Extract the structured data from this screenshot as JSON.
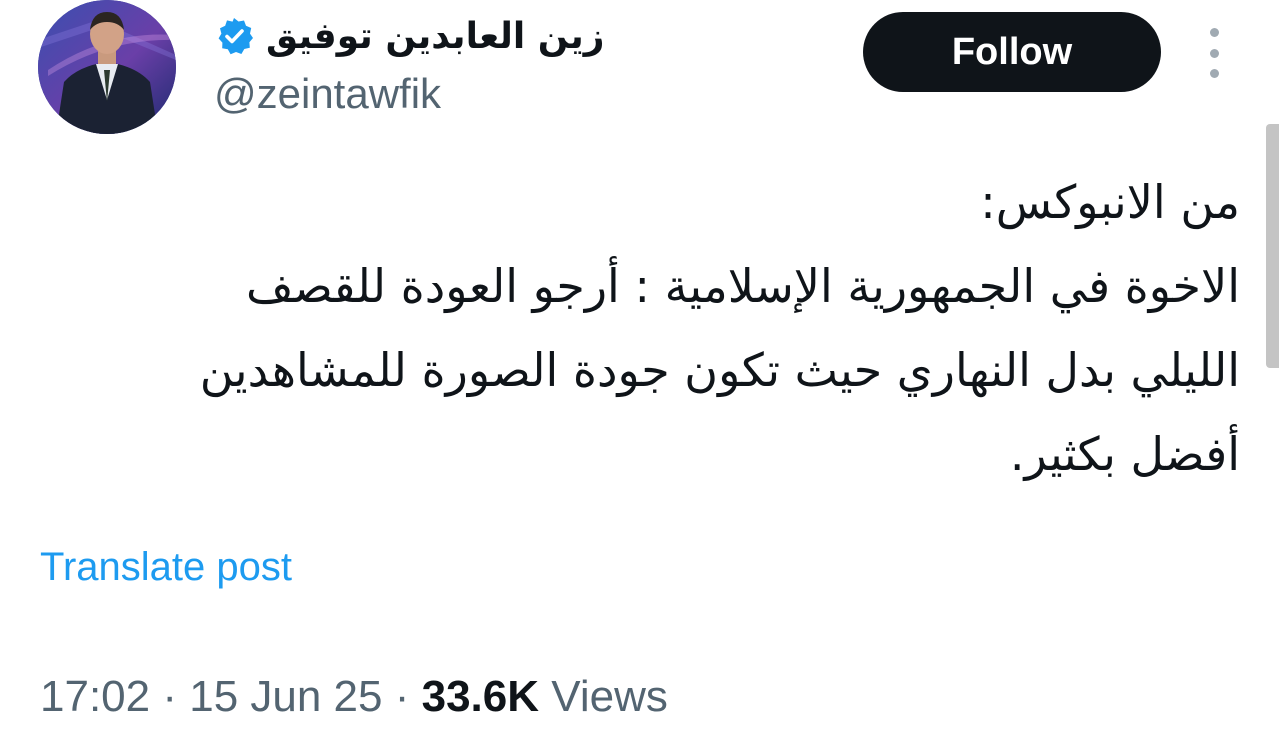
{
  "author": {
    "display_name": "زين العابدين توفيق",
    "handle": "@zeintawfik",
    "verified": true,
    "badge_color": "#1d9bf0"
  },
  "actions": {
    "follow_label": "Follow",
    "more_icon": "more-vertical-icon"
  },
  "post": {
    "lines": [
      "من الانبوكس:",
      "الاخوة في الجمهورية الإسلامية : أرجو العودة للقصف",
      "الليلي بدل النهاري حيث تكون جودة الصورة للمشاهدين",
      "أفضل بكثير."
    ],
    "translate_label": "Translate post"
  },
  "meta": {
    "time": "17:02",
    "separator": " · ",
    "date": "15 Jun 25",
    "views_count": "33.6K",
    "views_label": "Views"
  },
  "colors": {
    "text_primary": "#0f1419",
    "text_secondary": "#536471",
    "link": "#1d9bf0",
    "button_bg": "#0f1419"
  }
}
